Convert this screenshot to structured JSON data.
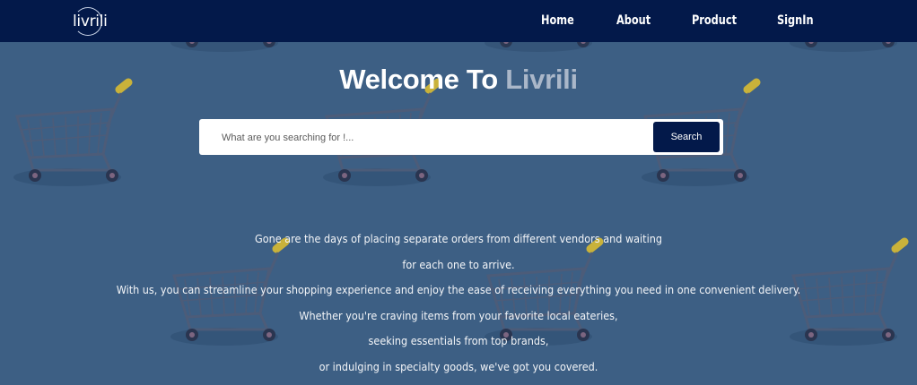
{
  "nav": {
    "logo_text": "livrili",
    "links": [
      {
        "label": "Home"
      },
      {
        "label": "About"
      },
      {
        "label": "Product"
      },
      {
        "label": "SignIn"
      }
    ]
  },
  "hero": {
    "title_prefix": "Welcome To ",
    "title_brand": "Livrili"
  },
  "search": {
    "placeholder": "What are you searching for !...",
    "value": "",
    "button_label": "Search"
  },
  "description": {
    "lines": [
      "Gone are the days of placing separate orders from different vendors and waiting",
      "for each one to arrive.",
      "With us, you can streamline your shopping experience and enjoy the ease of receiving everything you need in one convenient delivery.",
      "Whether you're craving items from your favorite local eateries,",
      "seeking essentials from top brands,",
      "or indulging in specialty goods, we've got you covered."
    ]
  },
  "colors": {
    "nav_bg": "#03194a",
    "page_bg": "#3d5f84",
    "brand_accent": "#aab7c9",
    "button_bg": "#03194a"
  },
  "background_icon": "shopping-cart-icon"
}
